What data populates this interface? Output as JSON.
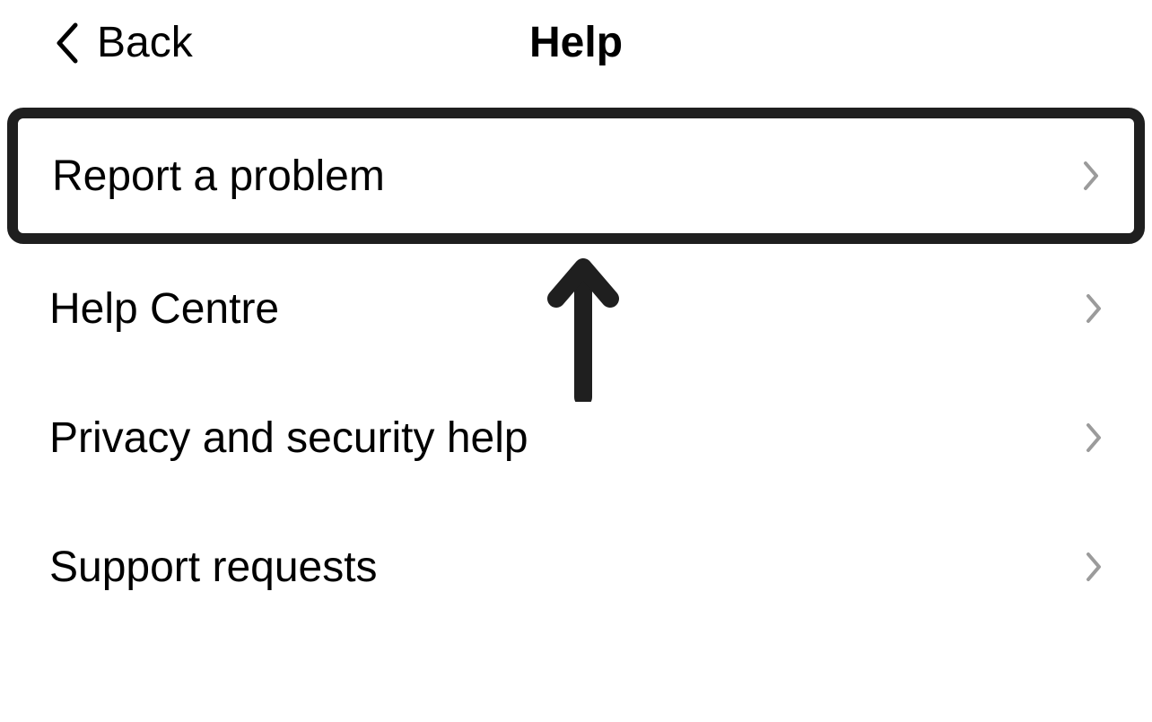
{
  "header": {
    "back_label": "Back",
    "title": "Help"
  },
  "menu": {
    "items": [
      {
        "label": "Report a problem",
        "highlighted": true
      },
      {
        "label": "Help Centre",
        "highlighted": false
      },
      {
        "label": "Privacy and security help",
        "highlighted": false
      },
      {
        "label": "Support requests",
        "highlighted": false
      }
    ]
  }
}
